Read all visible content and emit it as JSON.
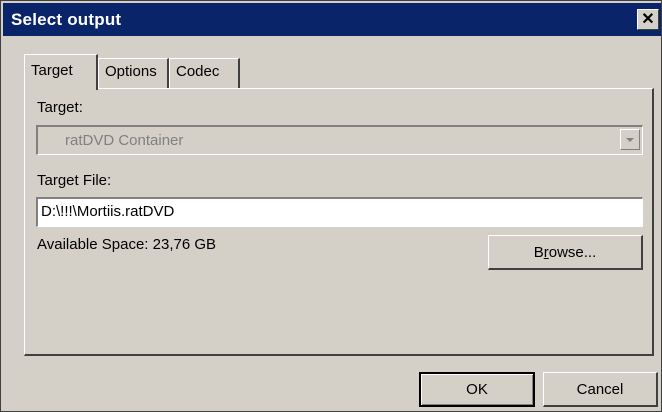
{
  "window": {
    "title": "Select output"
  },
  "tabs": [
    {
      "label": "Target",
      "active": true
    },
    {
      "label": "Options",
      "active": false
    },
    {
      "label": "Codec",
      "active": false
    }
  ],
  "target": {
    "label": "Target:",
    "selected_value": "ratDVD Container",
    "enabled": false
  },
  "target_file": {
    "label": "Target File:",
    "value": "D:\\!!!\\Mortiis.ratDVD"
  },
  "available_space": {
    "text": "Available Space: 23,76 GB"
  },
  "buttons": {
    "browse_prefix": "B",
    "browse_mnemonic": "r",
    "browse_suffix": "owse...",
    "ok": "OK",
    "cancel": "Cancel"
  },
  "icons": {
    "close": "close-icon",
    "dropdown": "chevron-down-icon"
  }
}
